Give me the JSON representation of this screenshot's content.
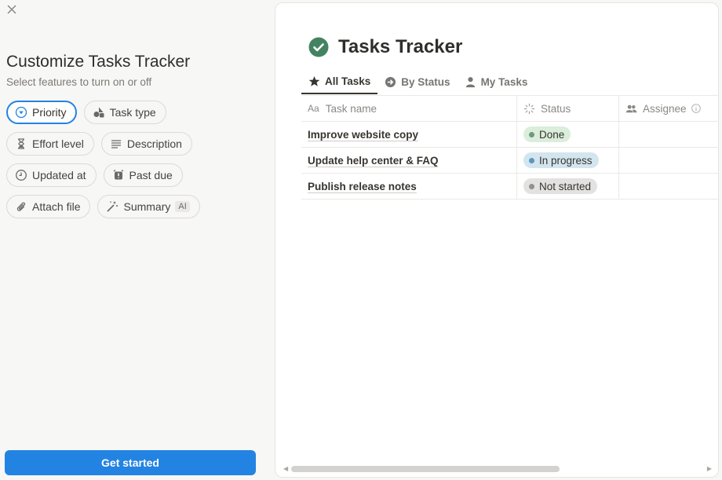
{
  "panel": {
    "title": "Customize Tasks Tracker",
    "subtitle": "Select features to turn on or off",
    "chips": [
      [
        {
          "label": "Priority",
          "icon": "priority-icon",
          "selected": true
        },
        {
          "label": "Task type",
          "icon": "shapes-icon",
          "selected": false
        }
      ],
      [
        {
          "label": "Effort level",
          "icon": "hourglass-icon",
          "selected": false
        },
        {
          "label": "Description",
          "icon": "text-lines-icon",
          "selected": false
        }
      ],
      [
        {
          "label": "Updated at",
          "icon": "clock-icon",
          "selected": false
        },
        {
          "label": "Past due",
          "icon": "alarm-icon",
          "selected": false
        }
      ],
      [
        {
          "label": "Attach file",
          "icon": "paperclip-icon",
          "selected": false
        },
        {
          "label": "Summary",
          "icon": "magic-wand-icon",
          "selected": false,
          "badge": "AI"
        }
      ]
    ],
    "cta": "Get started"
  },
  "preview": {
    "title": "Tasks Tracker",
    "tabs": [
      {
        "label": "All Tasks",
        "icon": "star-icon",
        "active": true
      },
      {
        "label": "By Status",
        "icon": "arrow-circle-icon",
        "active": false
      },
      {
        "label": "My Tasks",
        "icon": "person-icon",
        "active": false
      }
    ],
    "columns": {
      "name_prefix": "Aa",
      "name": "Task name",
      "status": "Status",
      "assignee": "Assignee"
    },
    "rows": [
      {
        "name": "Improve website copy",
        "status": "Done"
      },
      {
        "name": "Update help center & FAQ",
        "status": "In progress"
      },
      {
        "name": "Publish release notes",
        "status": "Not started"
      }
    ],
    "status_colors": {
      "Done": {
        "bg": "#dbeddb",
        "dot": "#6c9b7d"
      },
      "In progress": {
        "bg": "#d3e5ef",
        "dot": "#5b97bd"
      },
      "Not started": {
        "bg": "#e3e2e0",
        "dot": "#91918e"
      }
    }
  },
  "colors": {
    "accent": "#2383e2",
    "check": "#448361"
  }
}
